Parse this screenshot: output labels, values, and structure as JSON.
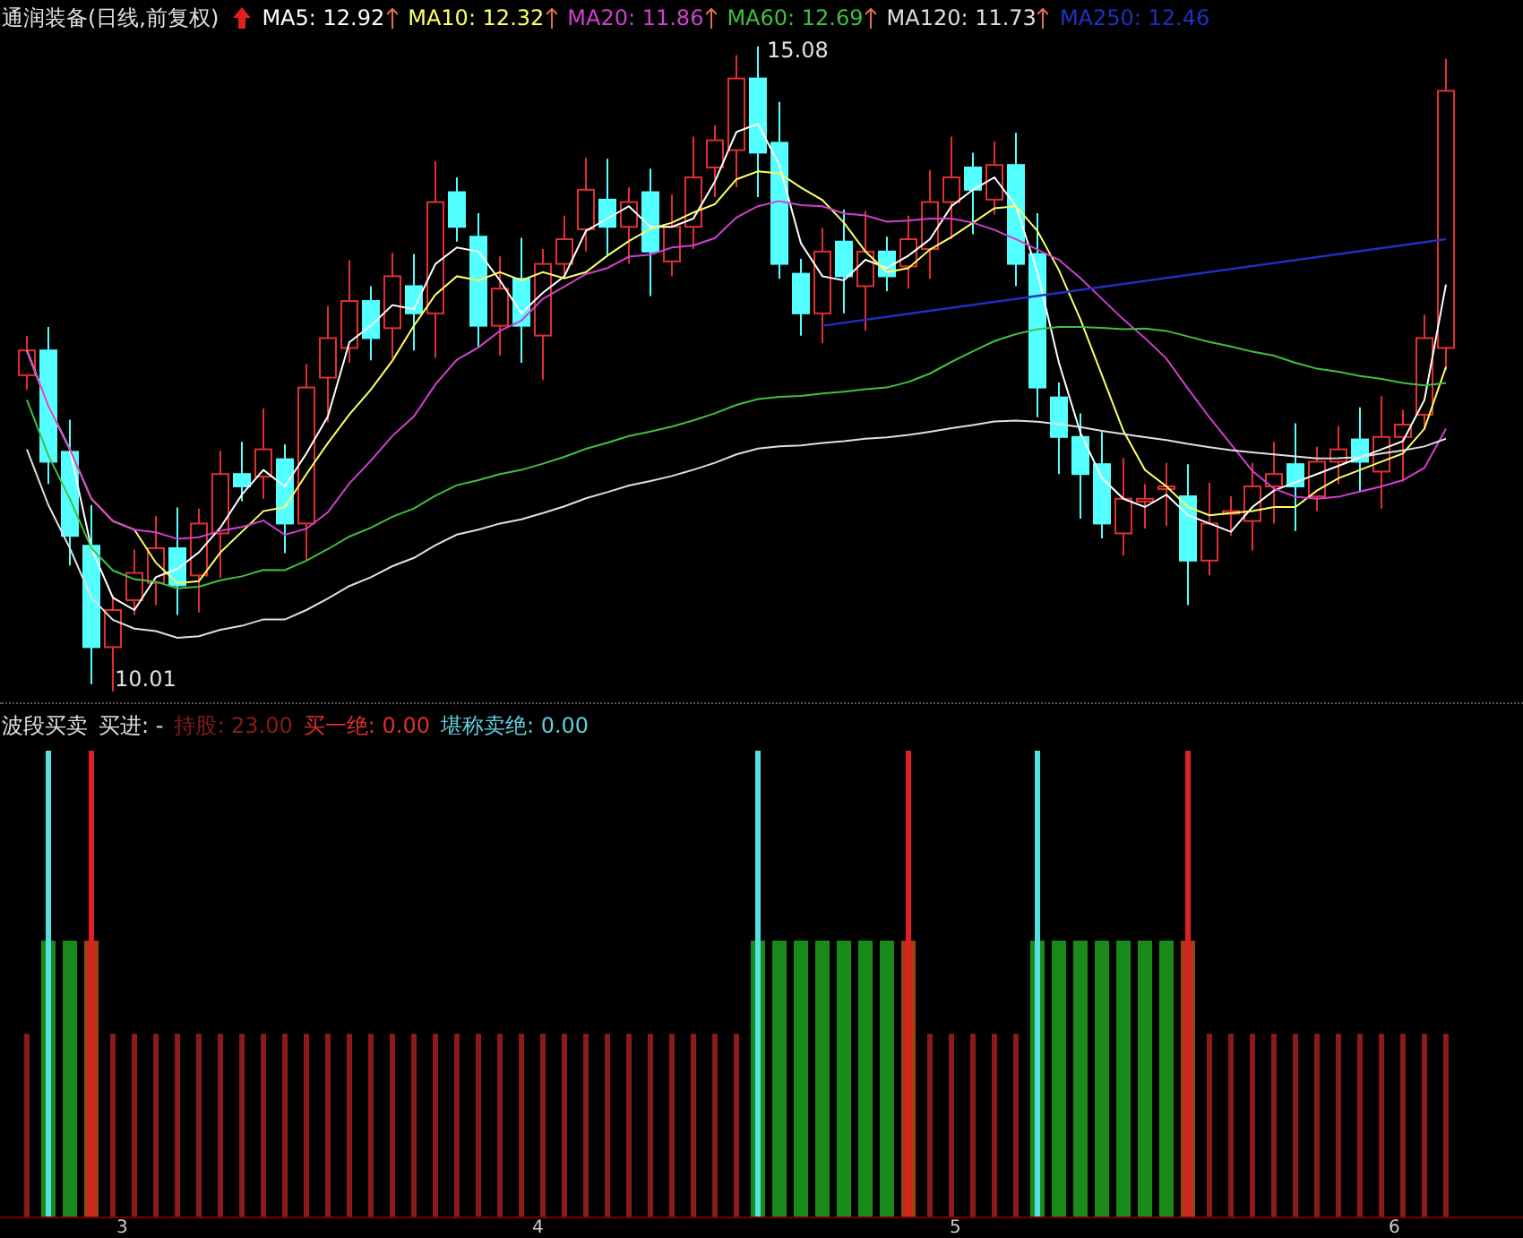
{
  "chart_title": "通润装备(日线,前复权)",
  "ma_legend": [
    {
      "label": "MA5: 12.92",
      "color": "#ffffff",
      "rising": true
    },
    {
      "label": "MA10: 12.32",
      "color": "#ffff66",
      "rising": true
    },
    {
      "label": "MA20: 11.86",
      "color": "#d040d0",
      "rising": true
    },
    {
      "label": "MA60: 12.69",
      "color": "#40c040",
      "rising": true
    },
    {
      "label": "MA120: 11.73",
      "color": "#e0e0e0",
      "rising": true
    },
    {
      "label": "MA250: 12.46",
      "color": "#2030c0",
      "rising": false
    }
  ],
  "price_labels": {
    "high": "15.08",
    "low": "10.01"
  },
  "indicator": {
    "name": "波段买卖",
    "items": [
      {
        "label": "买进: -",
        "color": "#e0e0e0"
      },
      {
        "label": "持股: 23.00",
        "color": "#8b1a1a"
      },
      {
        "label": "买一绝: 0.00",
        "color": "#e03030"
      },
      {
        "label": "堪称卖绝: 0.00",
        "color": "#60d0e0"
      }
    ]
  },
  "x_axis": [
    "3",
    "4",
    "5",
    "6"
  ]
}
